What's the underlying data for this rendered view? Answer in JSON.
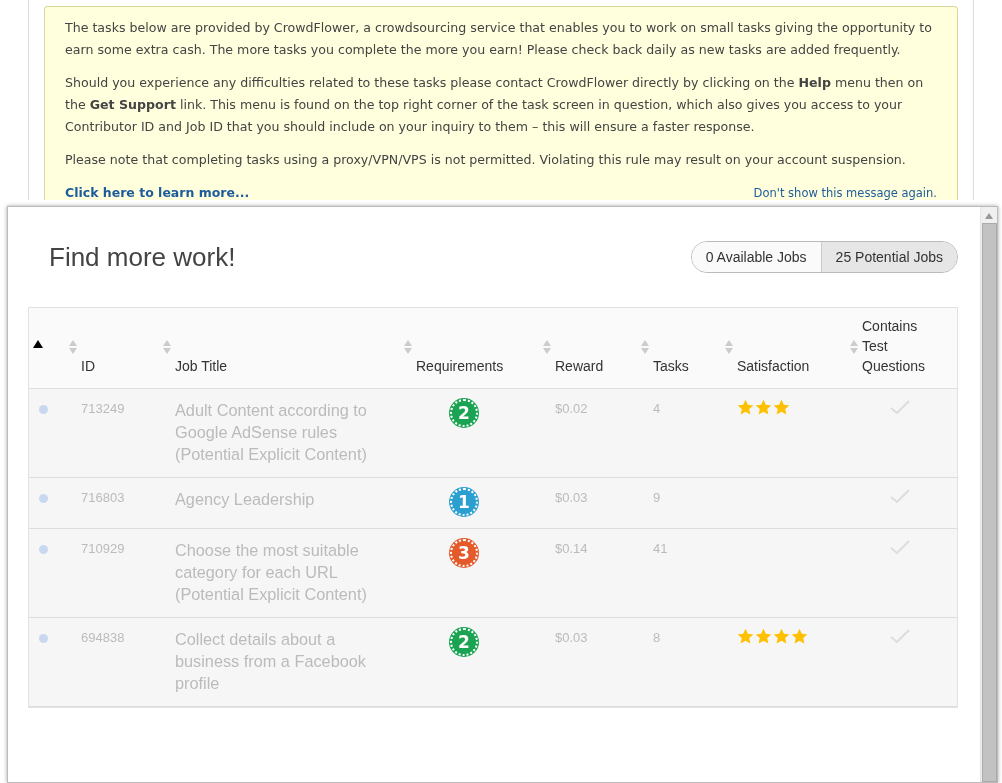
{
  "notice": {
    "paragraphs": [
      "The tasks below are provided by CrowdFlower, a crowdsourcing service that enables you to work on small tasks giving the opportunity to earn some extra cash. The more tasks you complete the more you earn! Please check back daily as new tasks are added frequently.",
      "Should you experience any difficulties related to these tasks please contact CrowdFlower directly by clicking on the **Help** menu then on the **Get Support** link. This menu is found on the top right corner of the task screen in question, which also gives you access to your Contributor ID and Job ID that you should include on your inquiry to them – this will ensure a faster response.",
      "Please note that completing tasks using a proxy/VPN/VPS is not permitted. Violating this rule may result on your account suspension."
    ],
    "learn_more": "Click here to learn more...",
    "dismiss": "Don't show this message again."
  },
  "panel": {
    "title": "Find more work!",
    "toggle": [
      {
        "label": "0 Available Jobs",
        "selected": false
      },
      {
        "label": "25 Potential Jobs",
        "selected": true
      }
    ],
    "table": {
      "columns": [
        {
          "sorted": true
        },
        {
          "label": "ID",
          "sorted": false
        },
        {
          "label": "Job Title",
          "sorted": false
        },
        {
          "label": "Requirements",
          "sorted": false
        },
        {
          "label": "Reward",
          "sorted": false
        },
        {
          "label": "Tasks",
          "sorted": false
        },
        {
          "label": "Satisfaction",
          "sorted": false
        },
        {
          "label": "Contains Test Questions",
          "sorted": false
        }
      ],
      "rows": [
        {
          "id": "713249",
          "title": "Adult Content according to Google AdSense rules (Potential Explicit Content)",
          "requirement": "2",
          "color": "#1aa352",
          "reward": "$0.02",
          "tasks": "4",
          "stars": 3
        },
        {
          "id": "716803",
          "title": "Agency Leadership",
          "requirement": "1",
          "color": "#2b9fd0",
          "reward": "$0.03",
          "tasks": "9"
        },
        {
          "id": "710929",
          "title": "Choose the most suitable category for each URL (Potential Explicit Content)",
          "requirement": "3",
          "color": "#e55a2b",
          "reward": "$0.14",
          "tasks": "41"
        },
        {
          "id": "694838",
          "title": "Collect details about a business from a Facebook profile",
          "requirement": "2",
          "color": "#1aa352",
          "reward": "$0.03",
          "tasks": "8",
          "stars": 4
        }
      ]
    }
  }
}
